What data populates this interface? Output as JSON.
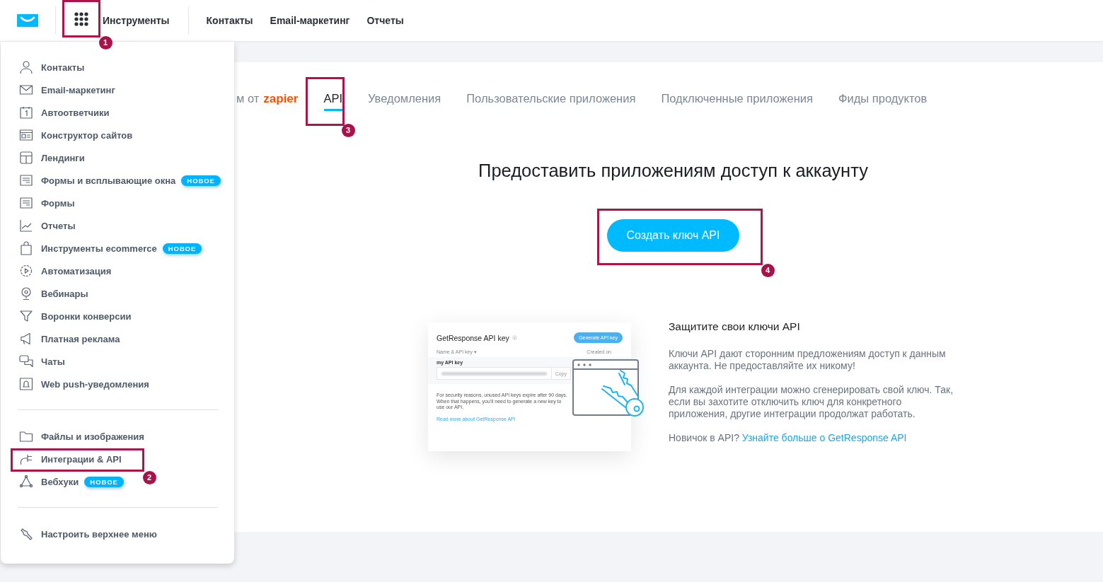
{
  "topbar": {
    "tools_label": "Инструменты",
    "nav": [
      "Контакты",
      "Email-маркетинг",
      "Отчеты"
    ]
  },
  "menu": {
    "groups": [
      [
        {
          "label": "Контакты"
        },
        {
          "label": "Email-маркетинг"
        },
        {
          "label": "Автоответчики"
        },
        {
          "label": "Конструктор сайтов"
        },
        {
          "label": "Лендинги"
        },
        {
          "label": "Формы и всплывающие окна",
          "badge": "НОВОЕ"
        },
        {
          "label": "Формы"
        },
        {
          "label": "Отчеты"
        },
        {
          "label": "Инструменты ecommerce",
          "badge": "НОВОЕ"
        },
        {
          "label": "Автоматизация"
        },
        {
          "label": "Вебинары"
        },
        {
          "label": "Воронки конверсии"
        },
        {
          "label": "Платная реклама"
        },
        {
          "label": "Чаты"
        },
        {
          "label": "Web push-уведомления"
        }
      ],
      [
        {
          "label": "Файлы и изображения"
        },
        {
          "label": "Интеграции & API"
        },
        {
          "label": "Вебхуки",
          "badge": "НОВОЕ"
        }
      ],
      [
        {
          "label": "Настроить верхнее меню"
        }
      ]
    ]
  },
  "tabs": [
    {
      "label": "м от",
      "logo": "zapier",
      "selected": false
    },
    {
      "label": "API",
      "selected": true
    },
    {
      "label": "Уведомления",
      "selected": false
    },
    {
      "label": "Пользовательские приложения",
      "selected": false
    },
    {
      "label": "Подключенные приложения",
      "selected": false
    },
    {
      "label": "Фиды продуктов",
      "selected": false
    }
  ],
  "heading": "Предоставить приложениям доступ к аккаунту",
  "create_button": "Создать ключ API",
  "illustration": {
    "title": "GetResponse API key",
    "generate_button": "Generate API key",
    "column_1": "Name & API key ▾",
    "column_2": "Created on",
    "key_name": "my API key",
    "copy_button": "Copy",
    "note": "For security reasons, unused API keys expire after 90 days. When that happens, you'll need to generate a new key to use our API.",
    "link": "Read more about GetResponse API"
  },
  "info": {
    "title": "Защитите свои ключи API",
    "paragraphs": [
      "Ключи API дают сторонним предложениям доступ к данным аккаунта. Не предоставляйте их никому!",
      "Для каждой интеграции можно сгенерировать свой ключ. Так, если вы захотите отключить ключ для конкретного приложения, другие интеграции продолжат работать."
    ],
    "question": "Новичок в API?",
    "link": "Узнайте больше о GetResponse API"
  },
  "annotations": [
    {
      "number": "1"
    },
    {
      "number": "2"
    },
    {
      "number": "3"
    },
    {
      "number": "4"
    }
  ]
}
